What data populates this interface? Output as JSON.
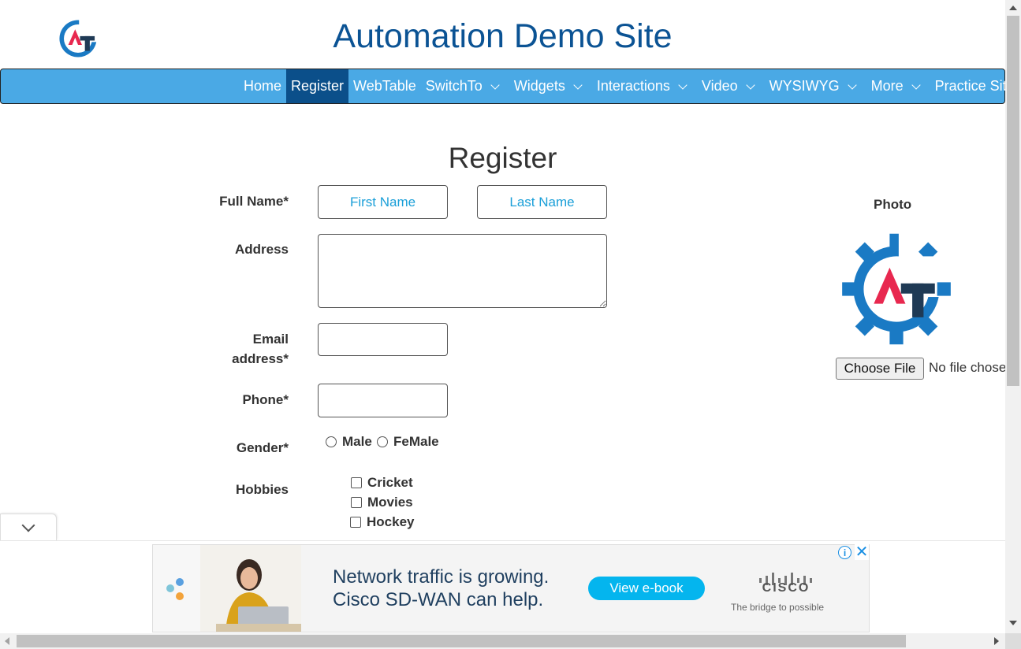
{
  "header": {
    "site_title": "Automation Demo Site",
    "logo_icon": "at-gear-logo-icon",
    "brand_colors": {
      "blue": "#1a7ac4",
      "red": "#e8284f",
      "dark": "#1f3a55"
    }
  },
  "nav": {
    "items": [
      {
        "label": "Home",
        "dropdown": false,
        "active": false
      },
      {
        "label": "Register",
        "dropdown": false,
        "active": true
      },
      {
        "label": "WebTable",
        "dropdown": false,
        "active": false
      },
      {
        "label": "SwitchTo",
        "dropdown": true,
        "active": false
      },
      {
        "label": "Widgets",
        "dropdown": true,
        "active": false
      },
      {
        "label": "Interactions",
        "dropdown": true,
        "active": false
      },
      {
        "label": "Video",
        "dropdown": true,
        "active": false
      },
      {
        "label": "WYSIWYG",
        "dropdown": true,
        "active": false
      },
      {
        "label": "More",
        "dropdown": true,
        "active": false
      },
      {
        "label": "Practice Site",
        "dropdown": false,
        "active": false
      }
    ],
    "bar_color": "#4aa9e5",
    "active_color": "#0b4f8a"
  },
  "form": {
    "title": "Register",
    "full_name_label": "Full Name*",
    "first_name_placeholder": "First Name",
    "last_name_placeholder": "Last Name",
    "address_label": "Address",
    "email_label_line1": "Email",
    "email_label_line2": "address*",
    "phone_label": "Phone*",
    "gender_label": "Gender*",
    "gender_options": [
      "Male",
      "FeMale"
    ],
    "hobbies_label": "Hobbies",
    "hobbies": [
      "Cricket",
      "Movies",
      "Hockey"
    ]
  },
  "photo": {
    "label": "Photo",
    "choose_file_label": "Choose File",
    "file_status": "No file chosen"
  },
  "ad": {
    "headline_line1": "Network traffic is growing.",
    "headline_line2": "Cisco SD-WAN can help.",
    "cta": "View e-book",
    "brand": "CISCO",
    "tagline": "The bridge to possible",
    "info_icon": "info-icon",
    "close_icon": "close-icon"
  }
}
